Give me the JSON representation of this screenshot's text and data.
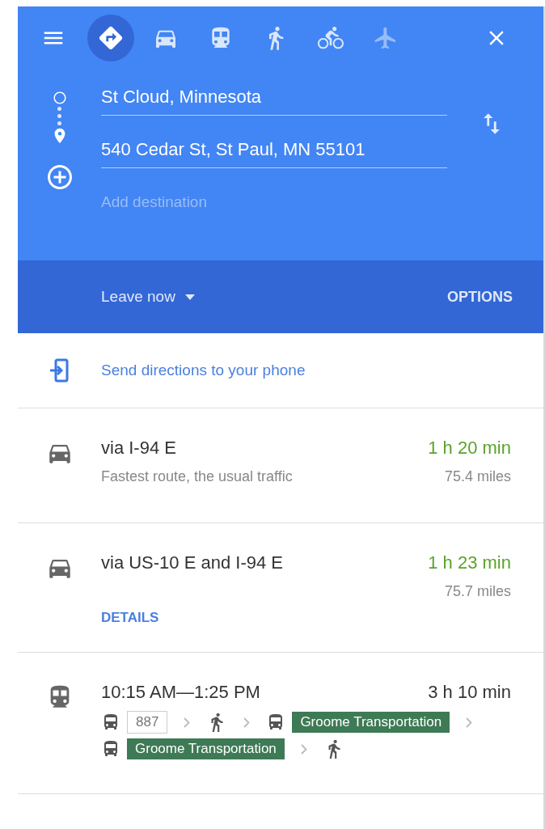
{
  "modes": [
    {
      "kind": "best",
      "selected": true,
      "disabled": false
    },
    {
      "kind": "car",
      "selected": false,
      "disabled": false
    },
    {
      "kind": "transit",
      "selected": false,
      "disabled": false
    },
    {
      "kind": "walk",
      "selected": false,
      "disabled": false
    },
    {
      "kind": "bike",
      "selected": false,
      "disabled": false
    },
    {
      "kind": "flight",
      "selected": false,
      "disabled": true
    }
  ],
  "stops": [
    {
      "kind": "origin",
      "value": "St Cloud, Minnesota"
    },
    {
      "kind": "destination",
      "value": "540 Cedar St, St Paul, MN 55101"
    }
  ],
  "add_destination": {
    "placeholder": "Add destination"
  },
  "departure": {
    "label": "Leave now",
    "options": "OPTIONS"
  },
  "send_to_phone": "Send directions to your phone",
  "routes": [
    {
      "kind": "car",
      "title": "via I-94 E",
      "subtitle": "Fastest route, the usual traffic",
      "duration": "1 h 20 min",
      "highlight": true,
      "distance": "75.4 miles"
    },
    {
      "kind": "car",
      "title": "via US-10 E and I-94 E",
      "duration": "1 h 23 min",
      "highlight": true,
      "distance": "75.7 miles",
      "link": "DETAILS"
    },
    {
      "kind": "transit",
      "title": "10:15 AM—1:25 PM",
      "duration": "3 h 10 min",
      "highlight": false,
      "steps": [
        {
          "kind": "bus",
          "line": "887"
        },
        {
          "kind": "walk"
        },
        {
          "kind": "bus",
          "line": "Groome Transportation",
          "color": "#3e7a55"
        },
        {
          "kind": "bus",
          "line": "Groome Transportation",
          "color": "#3e7a55"
        },
        {
          "kind": "walk"
        }
      ]
    }
  ]
}
